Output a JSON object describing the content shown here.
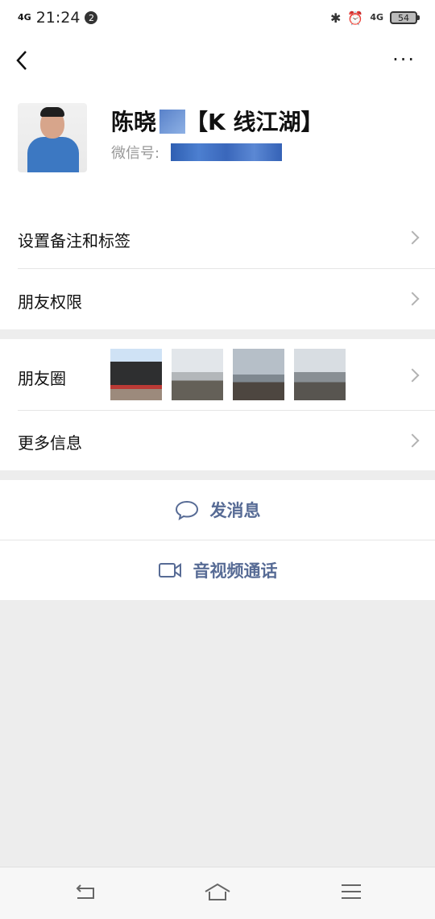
{
  "status_bar": {
    "network_left": "4G",
    "time": "21:24",
    "notification_count": "2",
    "network_right": "4G",
    "battery": "54"
  },
  "nav": {
    "back_icon": "chevron-left-icon",
    "more_label": "···"
  },
  "profile": {
    "name_prefix": "陈晓",
    "name_suffix": "【K 线江湖】",
    "wechat_id_label": "微信号:"
  },
  "menu": {
    "remark_tags": "设置备注和标签",
    "friend_permissions": "朋友权限",
    "moments": "朋友圈",
    "more_info": "更多信息"
  },
  "actions": {
    "send_message": "发消息",
    "av_call": "音视频通话"
  },
  "colors": {
    "link": "#576b95",
    "background": "#ededed"
  }
}
